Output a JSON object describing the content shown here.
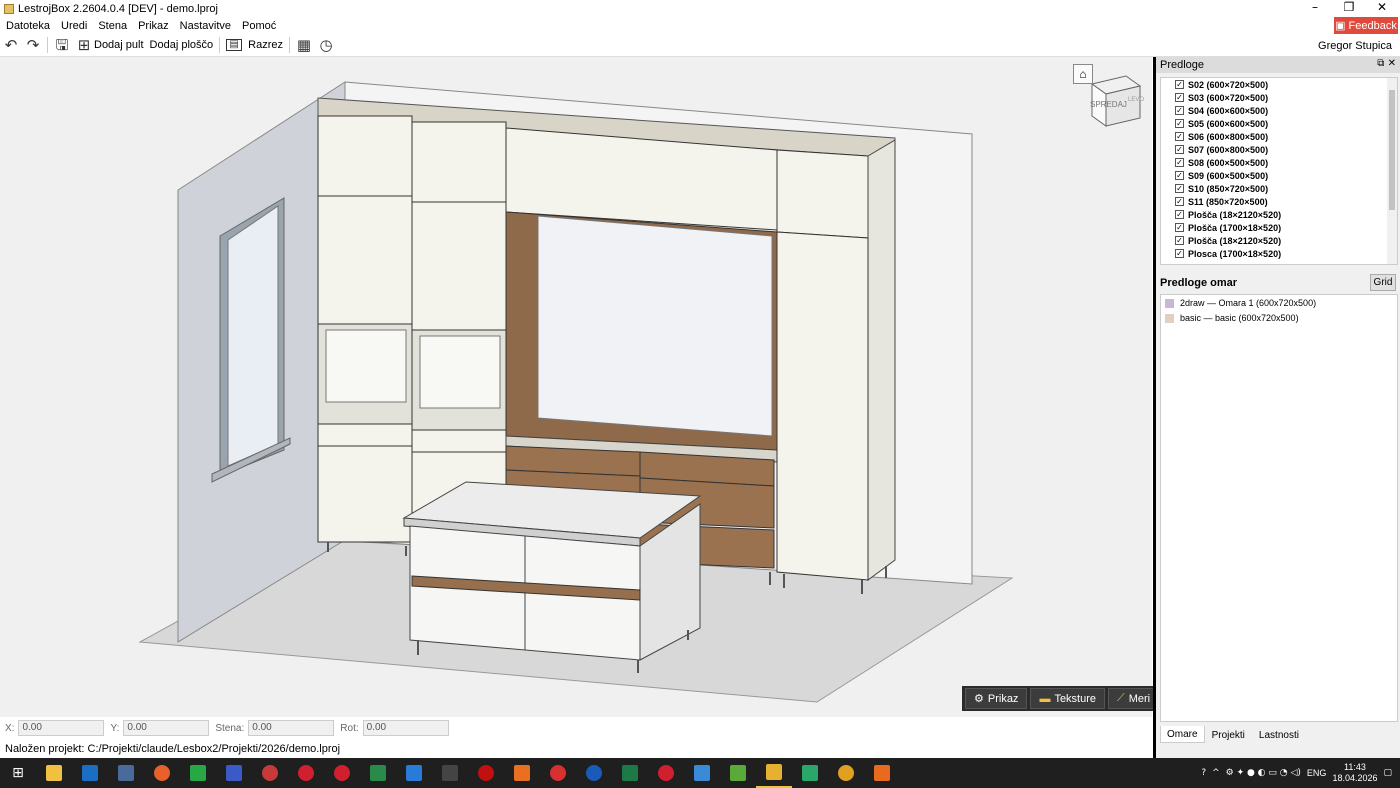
{
  "window": {
    "title": "LestrojBox 2.2604.0.4 [DEV] - demo.lproj",
    "minimize": "–",
    "restore": "❐",
    "close": "✕"
  },
  "menu": [
    "Datoteka",
    "Uredi",
    "Stena",
    "Prikaz",
    "Nastavitve",
    "Pomoć"
  ],
  "feedback": {
    "label": "Feedback",
    "color": "#e04a3c"
  },
  "toolbar": {
    "undo_icon": "undo-icon",
    "redo_icon": "redo-icon",
    "save_icon": "save-icon",
    "add_pult_label": "Dodaj pult",
    "add_ploscp_label": "Dodaj ploščo",
    "cnc_icon": "cnc-icon",
    "razrez_label": "Razrez",
    "grid_icon": "grid-icon",
    "clock_icon": "clock-icon"
  },
  "user": "Gregor Stupica",
  "viewcube": {
    "label": "SPREDAJ",
    "side": "LEVO",
    "home": "⌂"
  },
  "viewport_tools": {
    "prikaz": "Prikaz",
    "teksture": "Teksture",
    "meri": "Meri"
  },
  "coords": {
    "x_label": "X:",
    "x_value": "0.00",
    "y_label": "Y:",
    "y_value": "0.00",
    "stena_label": "Stena:",
    "stena_value": "0.00",
    "rot_label": "Rot:",
    "rot_value": "0.00"
  },
  "status": "Naložen projekt: C:/Projekti/claude/Lesbox2/Projekti/2026/demo.lproj",
  "predloge": {
    "title": "Predloge",
    "items": [
      "S02 (600×720×500)",
      "S03 (600×720×500)",
      "S04 (600×600×500)",
      "S05 (600×600×500)",
      "S06 (600×800×500)",
      "S07 (600×800×500)",
      "S08 (600×500×500)",
      "S09 (600×500×500)",
      "S10 (850×720×500)",
      "S11 (850×720×500)",
      "Plošča (18×2120×520)",
      "Plošča (1700×18×520)",
      "Plošča (18×2120×520)",
      "Plosca (1700×18×520)"
    ]
  },
  "omare": {
    "title": "Predloge omar",
    "grid_label": "Grid",
    "items": [
      {
        "label": "2draw — Omara 1 (600x720x500)",
        "color": "#c8b8d8"
      },
      {
        "label": "basic — basic (600x720x500)",
        "color": "#e0d0c0"
      }
    ]
  },
  "tabs": [
    "Omare",
    "Projekti",
    "Lastnosti"
  ],
  "clock": {
    "time": "11:43",
    "date": "18.04.2026",
    "lang": "ENG"
  }
}
